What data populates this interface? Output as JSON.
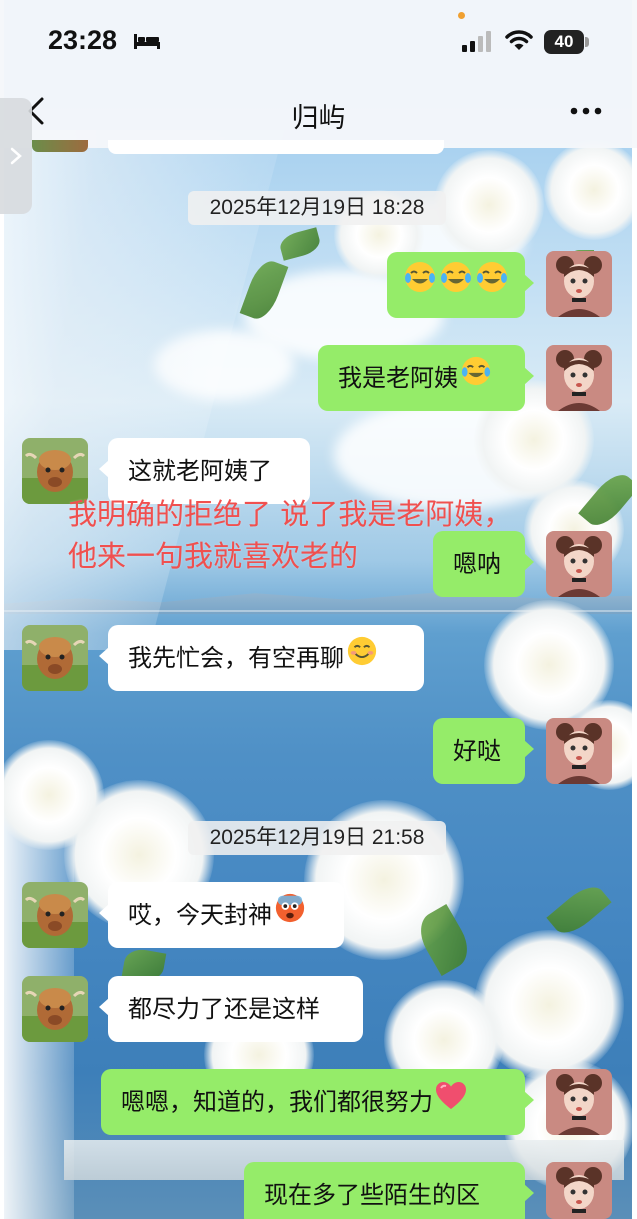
{
  "status_bar": {
    "time": "23:28",
    "battery_level": "40",
    "icons": [
      "bed-icon",
      "signal-icon",
      "wifi-icon",
      "battery-icon"
    ]
  },
  "nav": {
    "title": "归屿",
    "back_icon": "chevron-left-icon",
    "more_icon": "more-dots-icon"
  },
  "timestamps": [
    "2025年12月19日 18:28",
    "2025年12月19日 21:58"
  ],
  "messages": [
    {
      "side": "out",
      "text": "",
      "emojis": [
        "crying-laughing-emoji",
        "crying-laughing-emoji",
        "crying-laughing-emoji"
      ]
    },
    {
      "side": "out",
      "text": "我是老阿姨",
      "emojis": [
        "crying-laughing-emoji"
      ]
    },
    {
      "side": "in",
      "text": "这就老阿姨了",
      "emojis": []
    },
    {
      "side": "out",
      "text": "嗯呐",
      "emojis": []
    },
    {
      "side": "in",
      "text": "我先忙会，有空再聊",
      "emojis": [
        "smiling-emoji"
      ]
    },
    {
      "side": "out",
      "text": "好哒",
      "emojis": []
    },
    {
      "side": "in",
      "text": "哎，今天封神",
      "emojis": [
        "scared-face-emoji"
      ]
    },
    {
      "side": "in",
      "text": "都尽力了还是这样",
      "emojis": []
    },
    {
      "side": "out",
      "text": "嗯嗯，知道的，我们都很努力",
      "emojis": [
        "heart-emoji"
      ]
    },
    {
      "side": "out",
      "text": "现在多了些陌生的区",
      "emojis": []
    }
  ],
  "overlay_annotation": {
    "line1": "我明确的拒绝了  说了我是老阿姨，",
    "line2": "他来一句我就喜欢老的",
    "color": "#f0504f"
  },
  "colors": {
    "outgoing_bubble": "#95ec69",
    "incoming_bubble": "#ffffff",
    "status_bar_bg": "#f5f7fa"
  }
}
